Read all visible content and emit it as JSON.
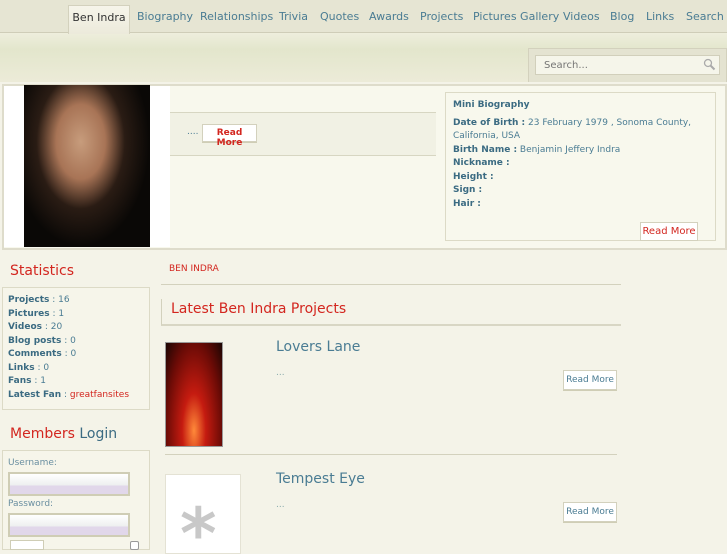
{
  "nav": {
    "active": "Ben Indra",
    "items": [
      "Biography",
      "Relationships",
      "Trivia",
      "Quotes",
      "Awards",
      "Projects",
      "Pictures Gallery",
      "Videos",
      "Blog",
      "Links",
      "Search"
    ]
  },
  "search": {
    "placeholder": "Search...",
    "icon": "magnifier-icon"
  },
  "intro": {
    "dots": "....",
    "read_more": "Read More"
  },
  "mini_bio": {
    "title": "Mini Biography",
    "dob_label": "Date of Birth :",
    "dob_value": "23 February 1979 , Sonoma County,",
    "dob_value2": "California, USA",
    "birth_name_label": "Birth Name :",
    "birth_name_value": "Benjamin Jeffery Indra",
    "nickname_label": "Nickname :",
    "height_label": "Height :",
    "sign_label": "Sign :",
    "hair_label": "Hair :",
    "read_more": "Read More"
  },
  "statistics": {
    "title": "Statistics",
    "items": [
      {
        "label": "Projects",
        "value": "16"
      },
      {
        "label": "Pictures",
        "value": "1"
      },
      {
        "label": "Videos",
        "value": "20"
      },
      {
        "label": "Blog posts",
        "value": "0"
      },
      {
        "label": "Comments",
        "value": "0"
      },
      {
        "label": "Links",
        "value": "0"
      },
      {
        "label": "Fans",
        "value": "1"
      }
    ],
    "latest_fan_label": "Latest Fan",
    "latest_fan_value": "greatfansites"
  },
  "login": {
    "title_a": "Members",
    "title_b": "Login",
    "username_label": "Username:",
    "password_label": "Password:",
    "username_value": "",
    "password_value": ""
  },
  "breadcrumb": "BEN INDRA",
  "projects": {
    "heading": "Latest Ben Indra Projects",
    "items": [
      {
        "title": "Lovers Lane",
        "excerpt": "...",
        "read_more": "Read More"
      },
      {
        "title": "Tempest Eye",
        "excerpt": "...",
        "read_more": "Read More"
      }
    ]
  }
}
